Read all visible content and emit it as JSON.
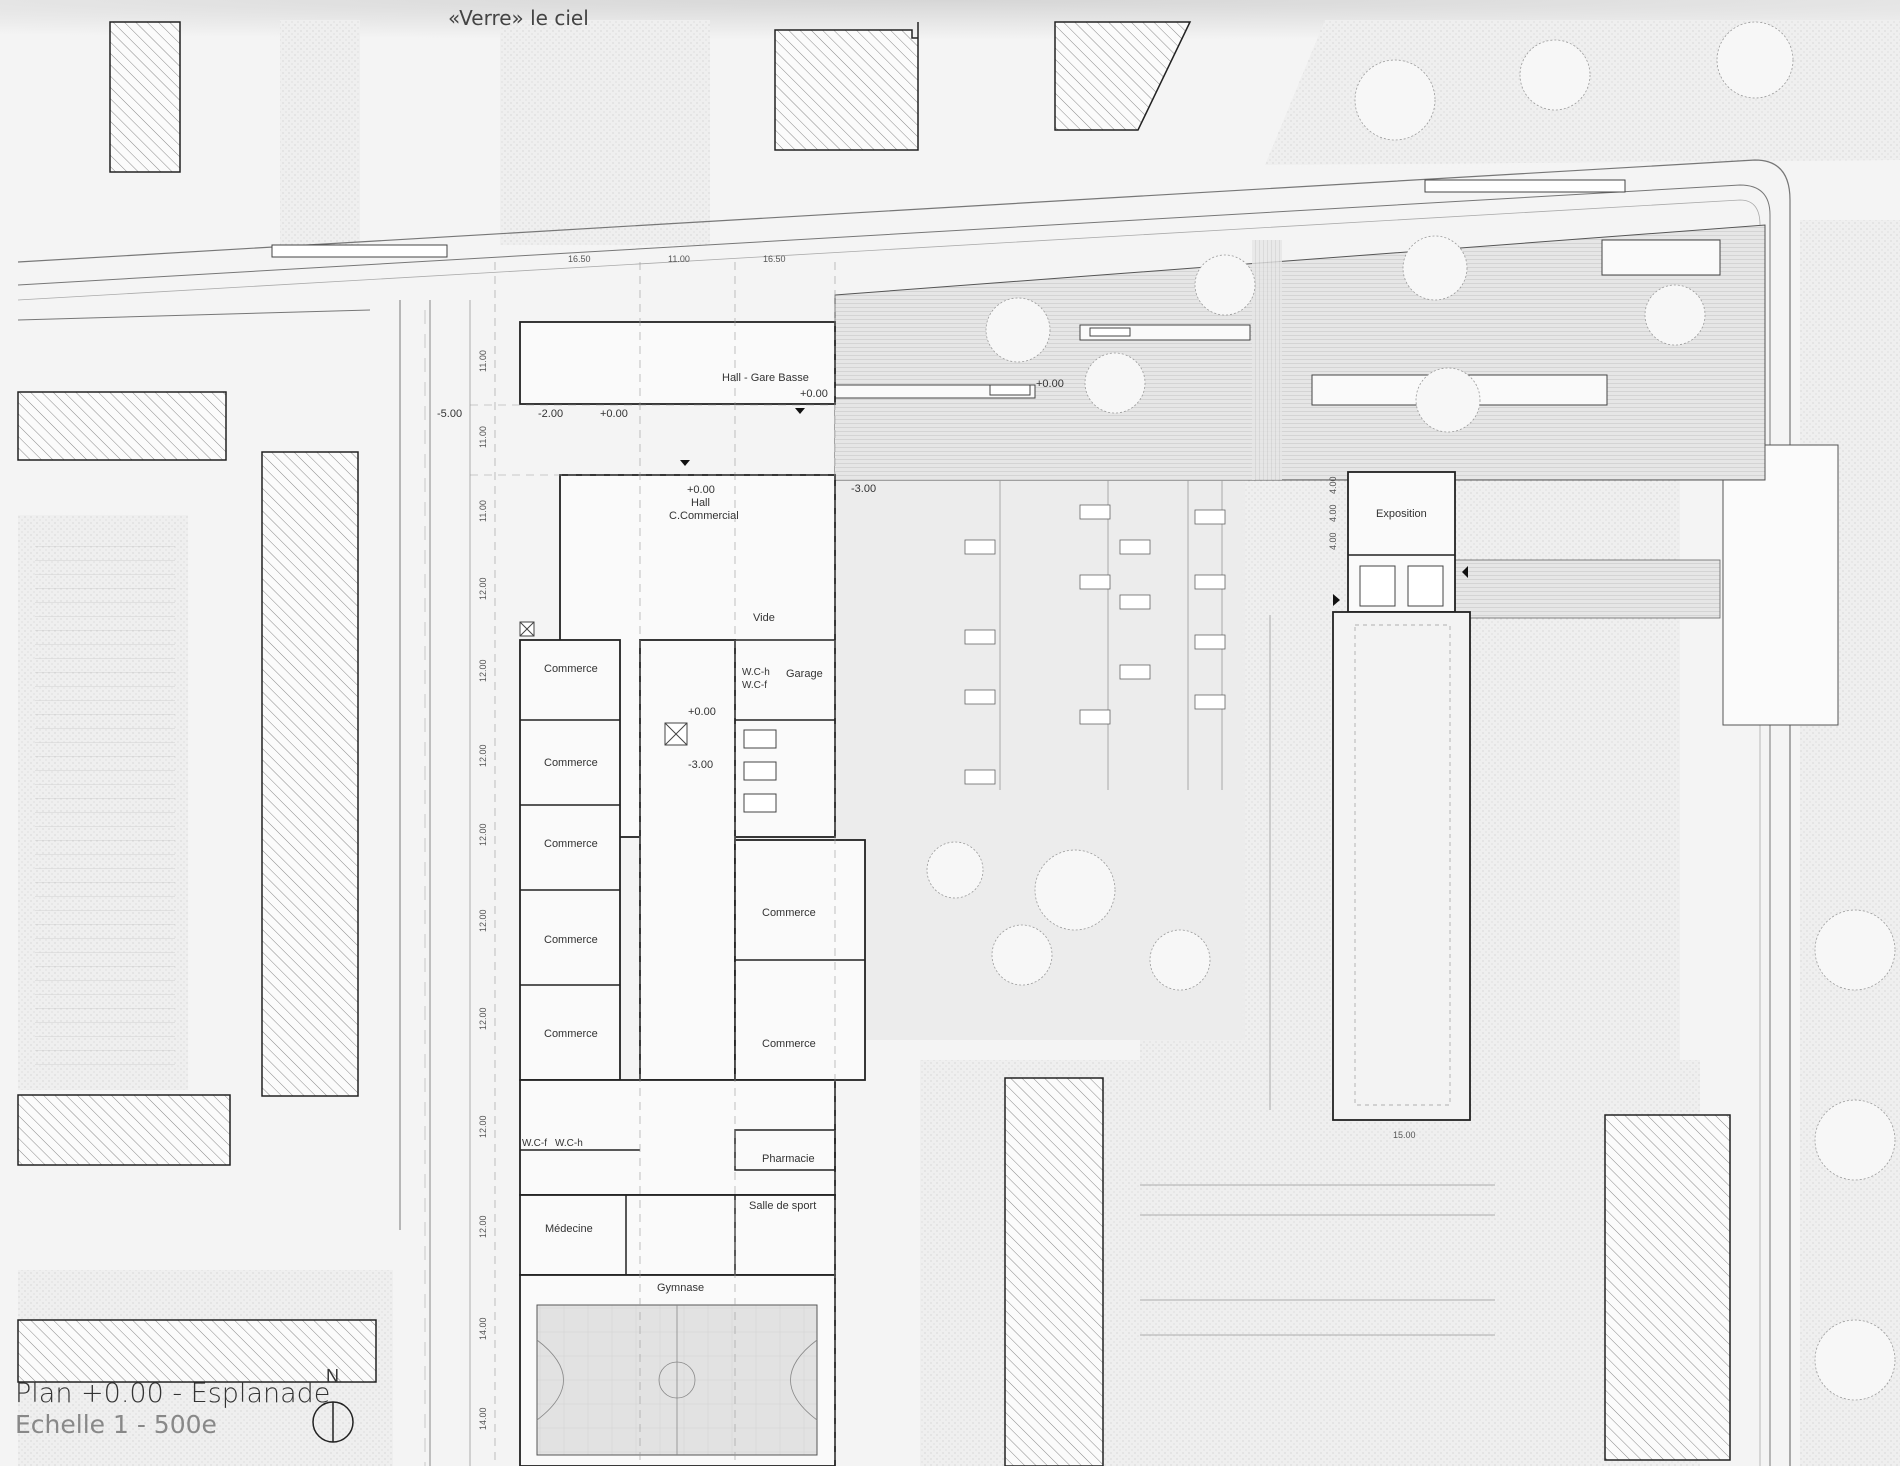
{
  "drawing": {
    "title": "«Verre» le ciel",
    "plan_name": "Plan +0.00 - Esplanade",
    "scale": "Echelle 1 - 500e",
    "north": "N"
  },
  "rooms": {
    "hall_gare": "Hall - Gare Basse",
    "hall_cc_1": "Hall",
    "hall_cc_2": "C.Commercial",
    "vide": "Vide",
    "garage": "Garage",
    "wc_h": "W.C-h",
    "wc_f": "W.C-f",
    "commerce": "Commerce",
    "pharmacie": "Pharmacie",
    "salle_sport": "Salle de sport",
    "medecine": "Médecine",
    "gymnase": "Gymnase",
    "exposition": "Exposition",
    "wc_f2": "W.C-f",
    "wc_h2": "W.C-h"
  },
  "levels": {
    "zero": "+0.00",
    "minus2": "-2.00",
    "minus3": "-3.00",
    "minus5": "-5.00"
  },
  "dimensions": {
    "d1650": "16.50",
    "d1100": "11.00",
    "d1200": "12.00",
    "d1400": "14.00",
    "d1500": "15.00",
    "d400": "4.00"
  }
}
